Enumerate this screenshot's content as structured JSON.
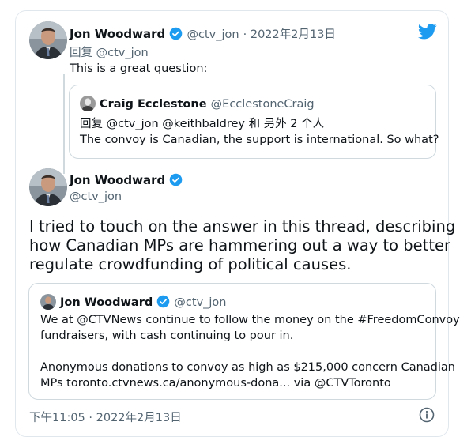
{
  "colors": {
    "twitter_blue": "#1d9bf0",
    "muted": "#536471",
    "border": "#cfd9de"
  },
  "reply_tweet": {
    "author_name": "Jon Woodward",
    "author_handle": "@ctv_jon",
    "date": "· 2022年2月13日",
    "reply_to": "回复 @ctv_jon",
    "text": "This is a great question:",
    "quoted": {
      "author_name": "Craig Ecclestone",
      "author_handle": "@EcclestoneCraig",
      "reply_to": "回复 @ctv_jon @keithbaldrey 和 另外 2 个人",
      "text": "The convoy is Canadian, the support is international.  So what?"
    }
  },
  "main_tweet": {
    "author_name": "Jon Woodward",
    "author_handle": "@ctv_jon",
    "text_lines": [
      "I tried to touch on the answer in this thread, describing",
      "how Canadian MPs are hammering out a way to better",
      "regulate crowdfunding of political causes."
    ],
    "quoted": {
      "author_name": "Jon Woodward",
      "author_handle": "@ctv_jon",
      "lines": [
        "We at @CTVNews continue to follow the money on the #FreedomConvoy",
        "fundraisers, with cash continuing to pour in.",
        "Anonymous donations to convoy as high as $215,000 concern Canadian",
        "MPs toronto.ctvnews.ca/anonymous-dona... via @CTVToronto"
      ]
    },
    "timestamp": "下午11:05 · 2022年2月13日"
  },
  "icons": {
    "logo": "twitter-bird-icon",
    "verified": "verified-badge-icon",
    "info": "info-icon"
  }
}
